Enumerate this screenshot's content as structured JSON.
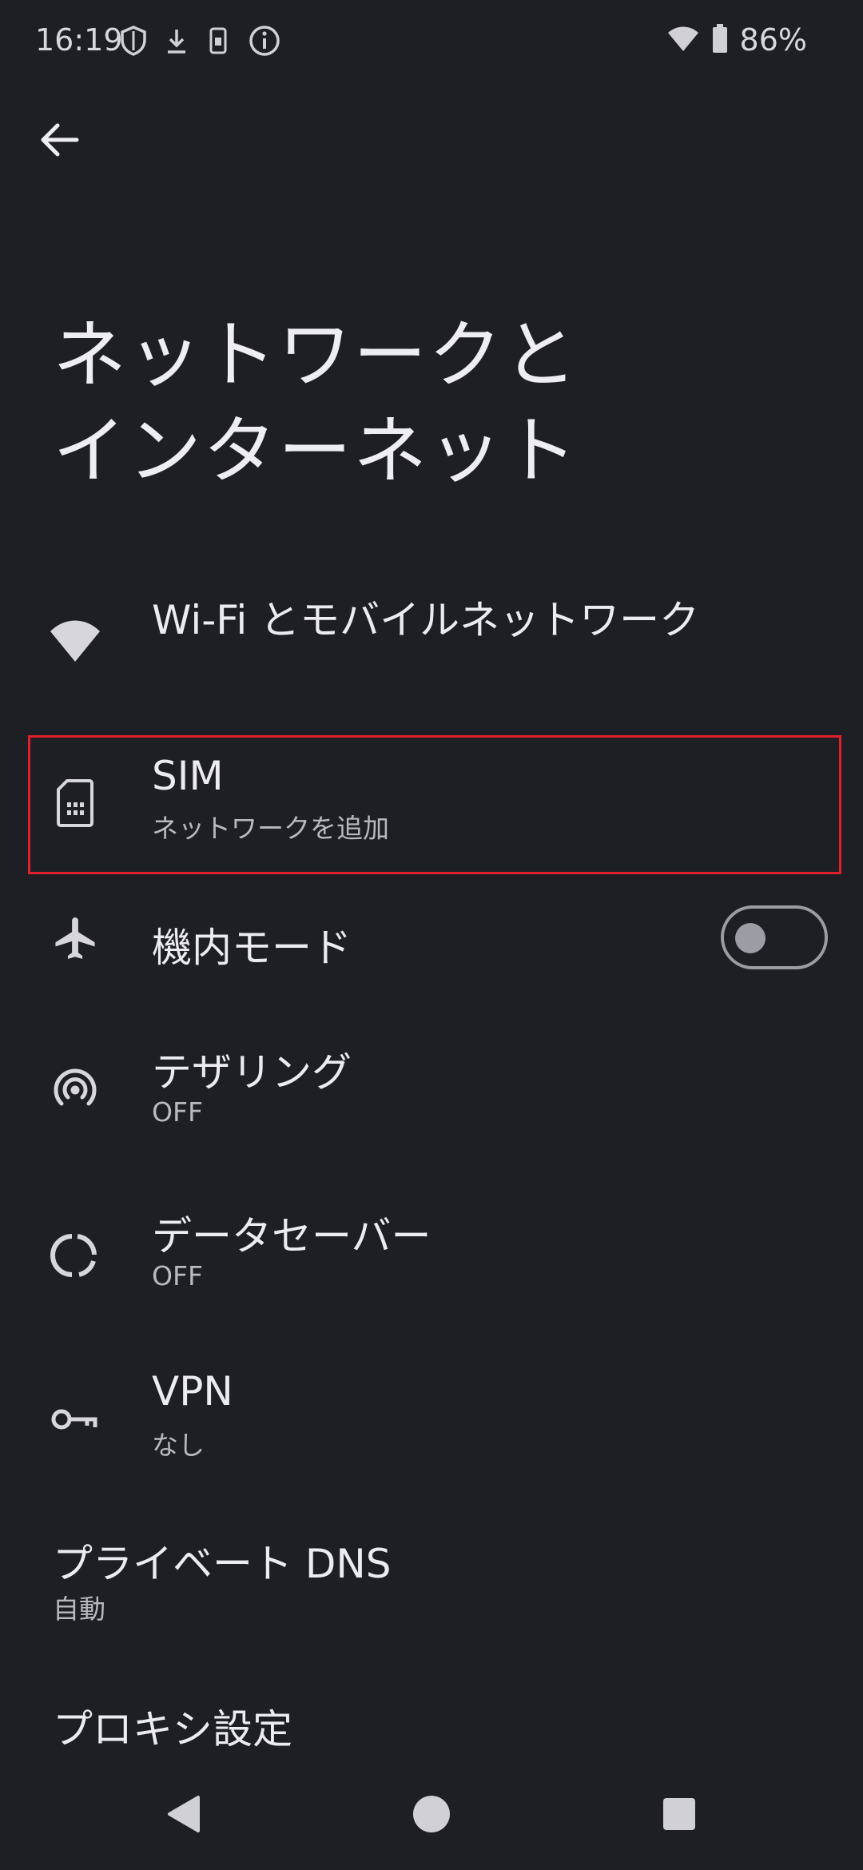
{
  "status_bar": {
    "time": "16:19",
    "battery": "86%",
    "icons_left": [
      "shield-icon",
      "download-icon",
      "sim-notification-icon",
      "info-icon"
    ],
    "icons_right": [
      "wifi-icon",
      "battery-icon"
    ]
  },
  "header": {
    "title_line1": "ネットワークと",
    "title_line2": "インターネット"
  },
  "items": {
    "wifi": {
      "title": "Wi-Fi とモバイルネットワーク",
      "icon": "wifi-icon"
    },
    "sim": {
      "title": "SIM",
      "subtitle": "ネットワークを追加",
      "icon": "sim-card-icon"
    },
    "airplane": {
      "title": "機内モード",
      "icon": "airplane-icon",
      "toggle_on": false
    },
    "tethering": {
      "title": "テザリング",
      "subtitle": "OFF",
      "icon": "hotspot-icon"
    },
    "data_saver": {
      "title": "データセーバー",
      "subtitle": "OFF",
      "icon": "data-saver-icon"
    },
    "vpn": {
      "title": "VPN",
      "subtitle": "なし",
      "icon": "key-icon"
    },
    "private_dns": {
      "title": "プライベート DNS",
      "subtitle": "自動"
    },
    "proxy": {
      "title": "プロキシ設定"
    }
  },
  "colors": {
    "background": "#1e1f24",
    "text": "#ececf0",
    "subtext": "#b9b9c0",
    "highlight": "#e0202a"
  }
}
